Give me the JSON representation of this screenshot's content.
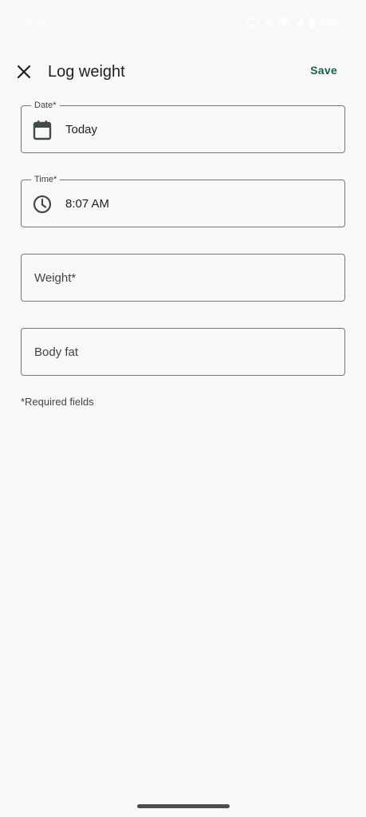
{
  "status_bar": {
    "time": "8:07",
    "battery": "96%",
    "icons": [
      "nfc-icon",
      "mute-icon",
      "wifi-icon",
      "signal-icon",
      "battery-icon"
    ]
  },
  "app_bar": {
    "close_icon": "close-icon",
    "title": "Log weight",
    "save_label": "Save"
  },
  "form": {
    "date": {
      "label": "Date*",
      "value": "Today",
      "icon": "calendar-icon"
    },
    "time": {
      "label": "Time*",
      "value": "8:07 AM",
      "icon": "clock-icon"
    },
    "weight": {
      "placeholder": "Weight*"
    },
    "body_fat": {
      "placeholder": "Body fat"
    },
    "helper_text": "*Required fields"
  },
  "colors": {
    "background": "#f8f9f6",
    "accent": "#18634e",
    "outline": "#747873"
  }
}
